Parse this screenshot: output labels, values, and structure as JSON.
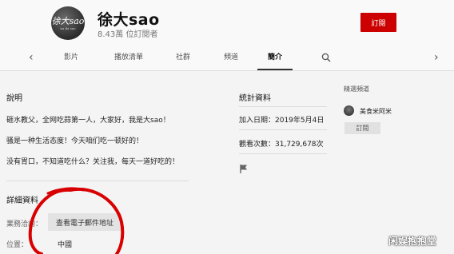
{
  "channel": {
    "avatar_text": "徐大sao",
    "avatar_subtext": "xu da sao",
    "name": "徐大sao",
    "subscribers": "8.43萬 位訂閱者",
    "subscribe_label": "訂閱"
  },
  "tabs": [
    "影片",
    "播放清單",
    "社群",
    "頻道",
    "簡介"
  ],
  "active_tab": "簡介",
  "about": {
    "description_title": "說明",
    "description_lines": [
      "砸水教父，全网吃蒜第一人，大家好，我是大sao！",
      "骚是一种生活态度！今天咱们吃一顿好的！",
      "没有胃口，不知道吃什么？关注我，每天一道好吃的！"
    ],
    "details_title": "詳細資料",
    "business_label": "業務洽詢：",
    "email_button": "查看電子郵件地址",
    "location_label": "位置：",
    "location_value": "中國"
  },
  "stats": {
    "title": "統計資料",
    "joined": "加入日期：2019年5月4日",
    "views": "觀看次數：31,729,678次"
  },
  "featured": {
    "title": "精選頻道",
    "channel_name": "美食米阿米",
    "subscribe_label": "訂閱"
  },
  "watermark": "闲娱抱抱堂",
  "colors": {
    "subscribe": "#cc0000",
    "annotation": "#d80000"
  }
}
